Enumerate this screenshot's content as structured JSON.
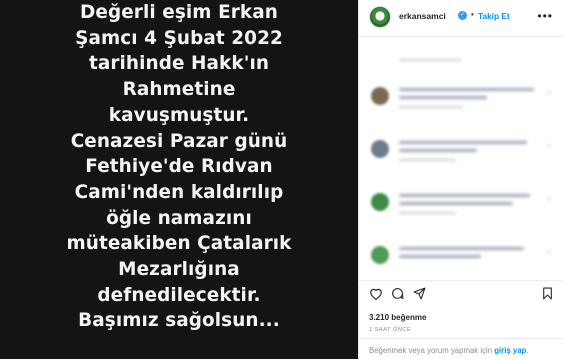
{
  "post_image": {
    "lines": [
      "Değerli eşim Erkan",
      "Şamcı 4 Şubat 2022",
      "tarihinde Hakk'ın",
      "Rahmetine",
      "kavuşmuştur.",
      "Cenazesi Pazar günü",
      "Fethiye'de Rıdvan",
      "Cami'nden kaldırılıp",
      "öğle namazını",
      "müteakiben Çatalarık",
      "Mezarlığına",
      "defnedilecektir.",
      "Başımız sağolsun..."
    ]
  },
  "header": {
    "username": "erkansamci",
    "separator": "•",
    "follow_label": "Takip Et",
    "more_icon": "more-horizontal-icon"
  },
  "comments_note": "",
  "stats": {
    "likes_count": "3.210",
    "likes_word": "beğenme",
    "time_ago": "1 SAAT ÖNCE"
  },
  "footer": {
    "prefix": "Beğenmek veya yorum yapmak için ",
    "login_label": "giriş yap",
    "suffix": "."
  },
  "colors": {
    "accent": "#0095f6",
    "post_background": "#141414",
    "text_primary": "#262626",
    "text_secondary": "#8e8e8e"
  }
}
